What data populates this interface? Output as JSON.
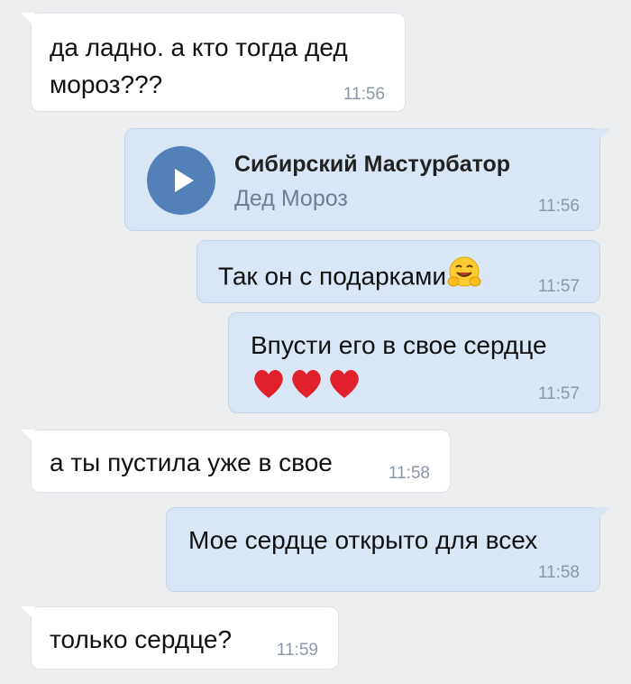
{
  "messages": [
    {
      "direction": "in",
      "lines": [
        "да ладно. а кто тогда дед",
        "мороз???"
      ],
      "time": "11:56"
    },
    {
      "direction": "out",
      "type": "audio",
      "track_title": "Сибирский Мастурбатор",
      "track_artist": "Дед Мороз",
      "time": "11:56"
    },
    {
      "direction": "out",
      "text": "Так он с подарками",
      "emoji": "hugging-face",
      "time": "11:57"
    },
    {
      "direction": "out",
      "text": "Впусти его в свое сердце",
      "emoji": "red-heart x3",
      "time": "11:57"
    },
    {
      "direction": "in",
      "text": "а ты пустила уже в свое",
      "time": "11:58"
    },
    {
      "direction": "out",
      "text": "Мое сердце открыто для всех",
      "time": "11:58"
    },
    {
      "direction": "in",
      "text": "только сердце?",
      "time": "11:59"
    }
  ],
  "colors": {
    "background": "#edeef0",
    "incoming_bubble": "#ffffff",
    "outgoing_bubble": "#d9e6f5",
    "play_button": "#5181b8",
    "timestamp": "#8a97a6"
  }
}
